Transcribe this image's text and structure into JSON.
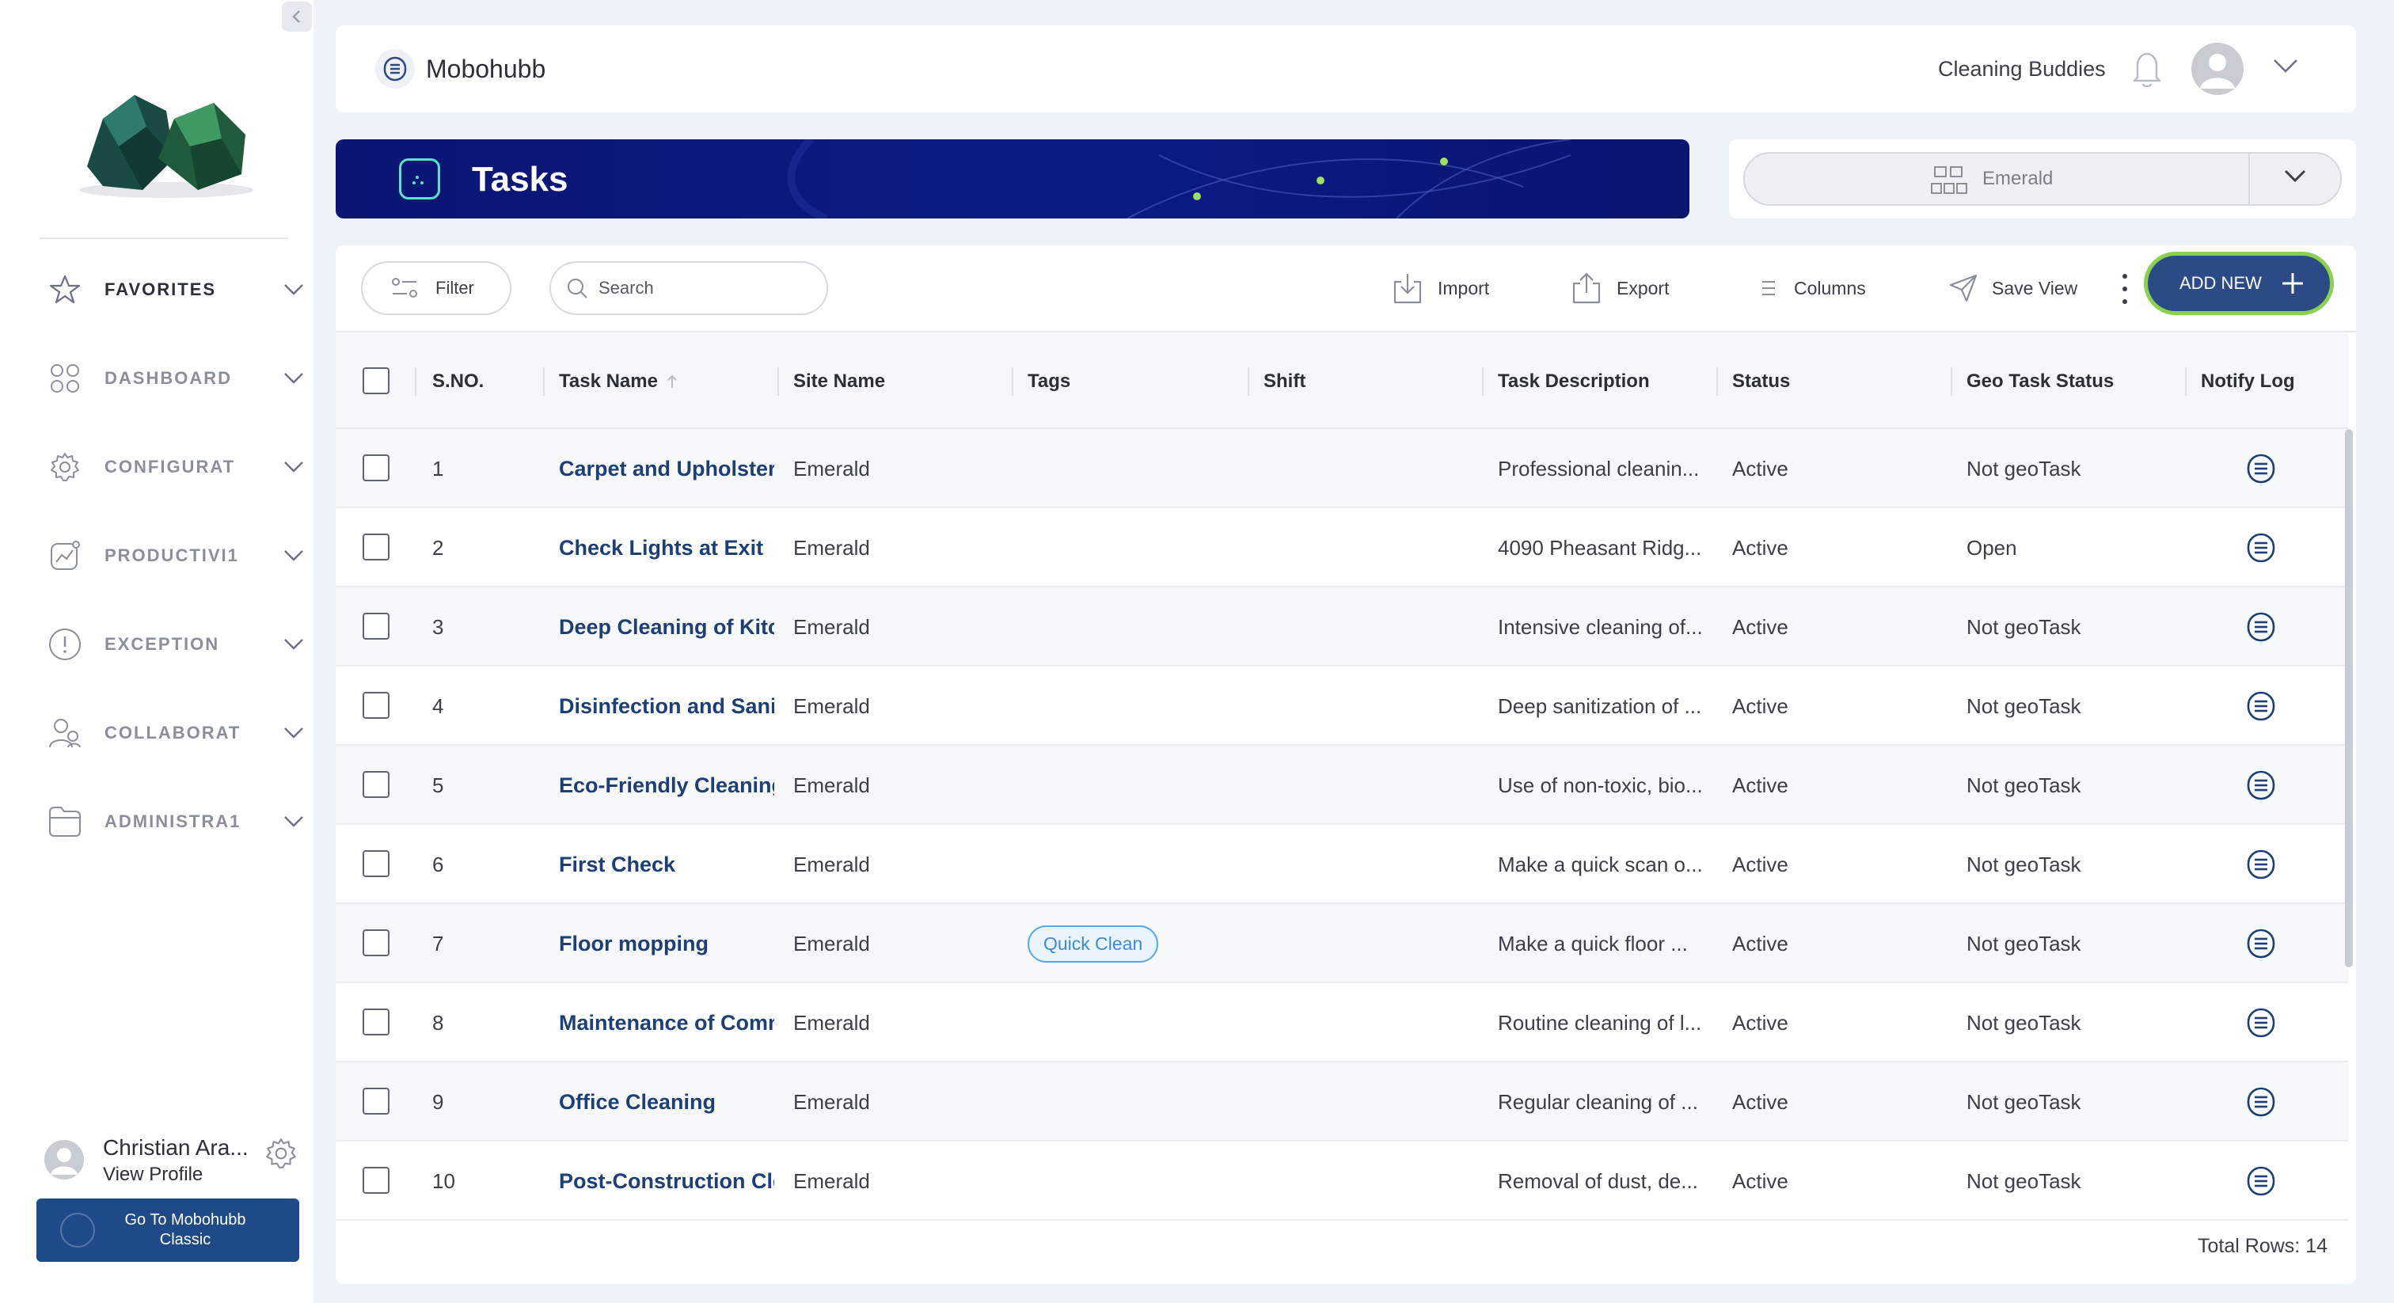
{
  "sidebar": {
    "nav": [
      {
        "label": "FAVORITES",
        "icon": "star-icon"
      },
      {
        "label": "DASHBOARD",
        "icon": "grid-icon"
      },
      {
        "label": "CONFIGURAT",
        "icon": "gear-icon"
      },
      {
        "label": "PRODUCTIVI1",
        "icon": "chart-icon"
      },
      {
        "label": "EXCEPTION",
        "icon": "alert-icon"
      },
      {
        "label": "COLLABORAT",
        "icon": "users-icon"
      },
      {
        "label": "ADMINISTRA1",
        "icon": "folder-icon"
      }
    ],
    "profile": {
      "name": "Christian Ara...",
      "link": "View Profile"
    },
    "classic_button": {
      "line1": "Go To Mobohubb",
      "line2": "Classic"
    }
  },
  "header": {
    "brand": "Mobohubb",
    "org_name": "Cleaning Buddies"
  },
  "banner": {
    "title": "Tasks"
  },
  "site_selector": {
    "value": "Emerald"
  },
  "toolbar": {
    "filter": "Filter",
    "search_placeholder": "Search",
    "import": "Import",
    "export": "Export",
    "columns": "Columns",
    "save_view": "Save View",
    "add_new": "ADD NEW"
  },
  "table": {
    "columns": [
      "S.NO.",
      "Task Name",
      "Site Name",
      "Tags",
      "Shift",
      "Task Description",
      "Status",
      "Geo Task Status",
      "Notify Log"
    ],
    "rows": [
      {
        "sno": "1",
        "task": "Carpet and Upholstery",
        "site": "Emerald",
        "tag": "",
        "shift": "",
        "desc": "Professional cleanin...",
        "status": "Active",
        "geo": "Not geoTask"
      },
      {
        "sno": "2",
        "task": "Check Lights at Exit",
        "site": "Emerald",
        "tag": "",
        "shift": "",
        "desc": "4090 Pheasant Ridg...",
        "status": "Active",
        "geo": "Open"
      },
      {
        "sno": "3",
        "task": "Deep Cleaning of Kitch",
        "site": "Emerald",
        "tag": "",
        "shift": "",
        "desc": "Intensive cleaning of...",
        "status": "Active",
        "geo": "Not geoTask"
      },
      {
        "sno": "4",
        "task": "Disinfection and Sanit",
        "site": "Emerald",
        "tag": "",
        "shift": "",
        "desc": "Deep sanitization of ...",
        "status": "Active",
        "geo": "Not geoTask"
      },
      {
        "sno": "5",
        "task": "Eco-Friendly Cleaning",
        "site": "Emerald",
        "tag": "",
        "shift": "",
        "desc": "Use of non-toxic, bio...",
        "status": "Active",
        "geo": "Not geoTask"
      },
      {
        "sno": "6",
        "task": "First Check",
        "site": "Emerald",
        "tag": "",
        "shift": "",
        "desc": "Make a quick scan o...",
        "status": "Active",
        "geo": "Not geoTask"
      },
      {
        "sno": "7",
        "task": "Floor mopping",
        "site": "Emerald",
        "tag": "Quick Clean",
        "shift": "",
        "desc": "Make a quick floor ...",
        "status": "Active",
        "geo": "Not geoTask"
      },
      {
        "sno": "8",
        "task": "Maintenance of Comm",
        "site": "Emerald",
        "tag": "",
        "shift": "",
        "desc": "Routine cleaning of l...",
        "status": "Active",
        "geo": "Not geoTask"
      },
      {
        "sno": "9",
        "task": "Office Cleaning",
        "site": "Emerald",
        "tag": "",
        "shift": "",
        "desc": "Regular cleaning of ...",
        "status": "Active",
        "geo": "Not geoTask"
      },
      {
        "sno": "10",
        "task": "Post-Construction Cle",
        "site": "Emerald",
        "tag": "",
        "shift": "",
        "desc": "Removal of dust, de...",
        "status": "Active",
        "geo": "Not geoTask"
      }
    ],
    "total_rows": "Total Rows: 14"
  },
  "colors": {
    "accent": "#2c4a86",
    "banner": "#0b1a86",
    "add_border": "#8bd14f",
    "task_link": "#1d3f73"
  }
}
